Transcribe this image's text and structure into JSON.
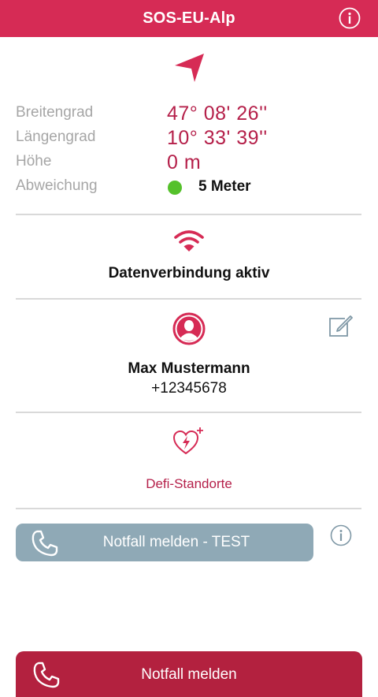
{
  "header": {
    "title": "SOS-EU-Alp",
    "info_icon": "info-circle-icon"
  },
  "location": {
    "icon": "navigation-arrow-icon",
    "rows": [
      {
        "label": "Breitengrad",
        "value": "47° 08' 26''"
      },
      {
        "label": "Längengrad",
        "value": "10° 33' 39''"
      },
      {
        "label": "Höhe",
        "value": "0 m"
      }
    ],
    "accuracy": {
      "label": "Abweichung",
      "value": "5 Meter",
      "status_color": "#55c12b"
    }
  },
  "connection": {
    "icon": "wifi-icon",
    "status": "Datenverbindung aktiv"
  },
  "contact": {
    "icon": "avatar-icon",
    "edit_icon": "edit-icon",
    "name": "Max Mustermann",
    "phone": "+12345678"
  },
  "defi": {
    "icon": "heart-defibrillator-icon",
    "label": "Defi-Standorte"
  },
  "actions": {
    "test_label": "Notfall melden - TEST",
    "emergency_label": "Notfall melden",
    "phone_icon": "phone-icon"
  },
  "colors": {
    "brand": "#d62b55",
    "accent": "#b5204a",
    "emergency_button": "#b3213f",
    "test_button": "#8fa9b6"
  }
}
